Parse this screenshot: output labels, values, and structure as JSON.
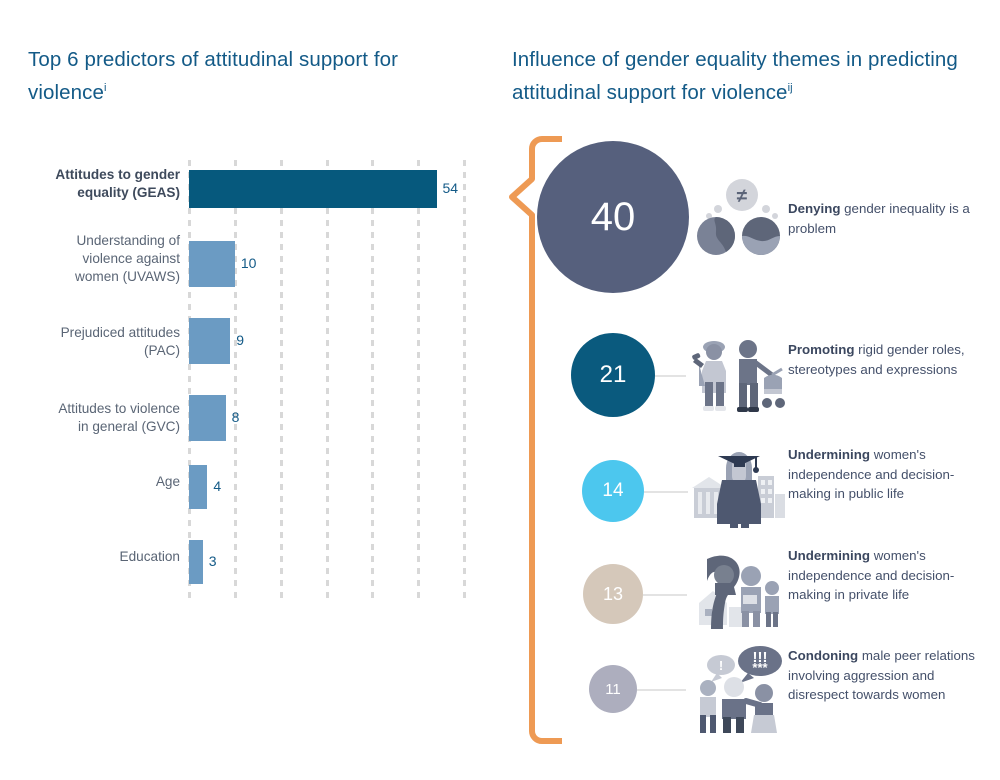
{
  "left_panel": {
    "title": "Top 6 predictors of attitudinal support for violence",
    "title_superscript": "i"
  },
  "right_panel": {
    "title": "Influence of gender equality themes in predicting attitudinal support for violence",
    "title_superscript": "ij"
  },
  "colors": {
    "title_blue": "#135A87",
    "bar_dark": "#06597D",
    "bar_light": "#6B9BC3",
    "value_text": "#135A87",
    "label_text": "#5A6575",
    "brace_orange": "#EE9A54",
    "bubble_40": "#56607D",
    "bubble_21": "#0A5A7E",
    "bubble_14": "#4CC7EE",
    "bubble_13": "#D5C8BA",
    "bubble_11": "#ADAEBE",
    "theme_text": "#44506A",
    "gridline": "#D8D8D8",
    "connector": "#E3E3E3"
  },
  "chart_data": {
    "type": "bar",
    "orientation": "horizontal",
    "title": "Top 6 predictors of attitudinal support for violence",
    "xlabel": "",
    "ylabel": "",
    "xlim": [
      0,
      60
    ],
    "grid": true,
    "gridlines_at": [
      0,
      10,
      20,
      30,
      40,
      50,
      60
    ],
    "categories": [
      "Attitudes to gender equality (GEAS)",
      "Understanding of violence against women (UVAWS)",
      "Prejudiced attitudes (PAC)",
      "Attitudes to violence in general (GVC)",
      "Age",
      "Education"
    ],
    "values": [
      54,
      10,
      9,
      8,
      4,
      3
    ],
    "bar_colors": [
      "#06597D",
      "#6B9BC3",
      "#6B9BC3",
      "#6B9BC3",
      "#6B9BC3",
      "#6B9BC3"
    ]
  },
  "bars": [
    {
      "label_lines": [
        "Attitudes to gender",
        "equality (GEAS)"
      ],
      "value": "54",
      "value_num": 54,
      "bold": true
    },
    {
      "label_lines": [
        "Understanding of",
        "violence against",
        "women (UVAWS)"
      ],
      "value": "10",
      "value_num": 10,
      "bold": false
    },
    {
      "label_lines": [
        "Prejudiced attitudes",
        "(PAC)"
      ],
      "value": "9",
      "value_num": 9,
      "bold": false
    },
    {
      "label_lines": [
        "Attitudes to violence",
        "in general (GVC)"
      ],
      "value": "8",
      "value_num": 8,
      "bold": false
    },
    {
      "label_lines": [
        "Age"
      ],
      "value": "4",
      "value_num": 4,
      "bold": false
    },
    {
      "label_lines": [
        "Education"
      ],
      "value": "3",
      "value_num": 3,
      "bold": false
    }
  ],
  "themes": [
    {
      "value": "40",
      "icon_name": "two-heads-thought-bubbles-not-equal-icon",
      "text_bold": "Denying",
      "text_rest": " gender inequality is a problem"
    },
    {
      "value": "21",
      "icon_name": "couple-with-pram-and-tools-icon",
      "text_bold": "Promoting",
      "text_rest": " rigid gender roles, stereotypes and expressions"
    },
    {
      "value": "14",
      "icon_name": "graduate-woman-public-buildings-icon",
      "text_bold": "Undermining",
      "text_rest": " women's independence and decision-making in public life"
    },
    {
      "value": "13",
      "icon_name": "family-at-home-icon",
      "text_bold": "Undermining",
      "text_rest": " women's independence and decision-making in private life"
    },
    {
      "value": "11",
      "icon_name": "group-speech-bubbles-exclamation-icon",
      "text_bold": "Condoning",
      "text_rest": " male peer relations involving aggression and disrespect towards women"
    }
  ]
}
